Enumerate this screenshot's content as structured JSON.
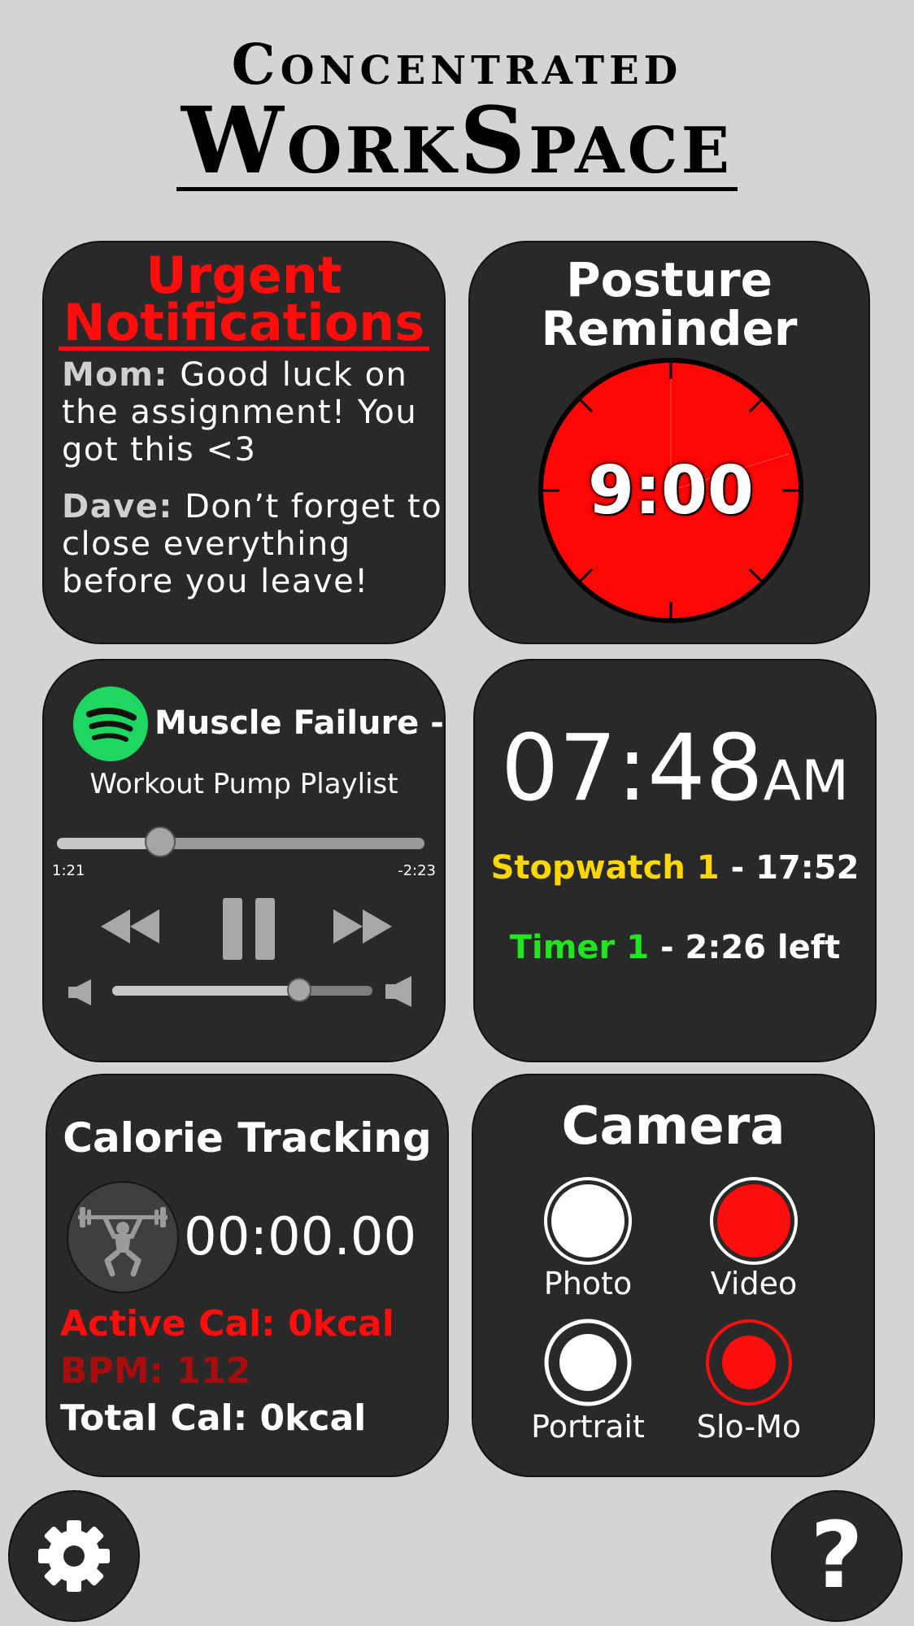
{
  "app": {
    "title_line1": "Concentrated",
    "title_line2": "WorkSpace"
  },
  "colors": {
    "background": "#d4d4d4",
    "card": "#292929",
    "urgent_red": "#ff0d0d",
    "stopwatch_yellow": "#ffd700",
    "timer_green": "#22e522",
    "spotify_green": "#1ed760"
  },
  "notifications": {
    "title_line1": "Urgent",
    "title_line2": "Notifications",
    "messages": [
      {
        "sender": "Mom:",
        "text": "Good luck on the assignment! You got this <3"
      },
      {
        "sender": "Dave:",
        "text": "Don’t forget to close everything before you leave!"
      }
    ]
  },
  "posture": {
    "title_line1": "Posture",
    "title_line2": "Reminder",
    "time": "9:00"
  },
  "music": {
    "icon": "spotify-icon",
    "title_line1": "Muscle Failure -",
    "title_line2": "Workout Pump Playlist",
    "elapsed": "1:21",
    "remaining": "-2:23",
    "progress_fraction": 0.28,
    "volume_fraction": 0.72,
    "controls": [
      "rewind-icon",
      "pause-icon",
      "fast-forward-icon",
      "volume-low-icon",
      "volume-high-icon"
    ]
  },
  "clock": {
    "time": "07:48",
    "ampm": "AM",
    "stopwatch_label": "Stopwatch 1",
    "stopwatch_value": " - 17:52",
    "timer_label": "Timer 1",
    "timer_value": " - 2:26 left"
  },
  "calories": {
    "title": "Calorie Tracking",
    "icon": "weightlifter-icon",
    "timer": "00:00.00",
    "active": "Active Cal: 0kcal",
    "bpm": "BPM: 112",
    "total": "Total Cal: 0kcal"
  },
  "camera": {
    "title": "Camera",
    "modes": [
      {
        "label": "Photo",
        "icon": "photo-shutter-icon"
      },
      {
        "label": "Video",
        "icon": "video-record-icon"
      },
      {
        "label": "Portrait",
        "icon": "portrait-shutter-icon"
      },
      {
        "label": "Slo-Mo",
        "icon": "slomo-record-icon"
      }
    ]
  },
  "corner_buttons": {
    "settings_icon": "gear-icon",
    "help_label": "?"
  }
}
